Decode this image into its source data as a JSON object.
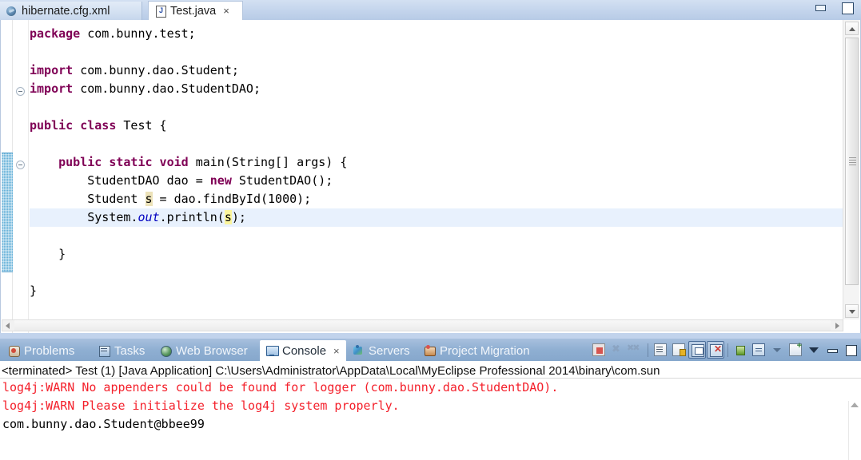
{
  "editor": {
    "tabs": [
      {
        "label": "hibernate.cfg.xml",
        "icon": "xml-file-icon",
        "active": false,
        "closable": false
      },
      {
        "label": "Test.java",
        "icon": "java-file-icon",
        "active": true,
        "closable": true,
        "close_glyph": "×"
      }
    ],
    "window_controls": {
      "minimize": "minimize-button",
      "maximize": "maximize-button"
    },
    "code_lines": [
      {
        "id": "l1",
        "tokens": [
          {
            "t": "kw",
            "s": "package"
          },
          {
            "t": "plain",
            "s": " com.bunny.test;"
          }
        ],
        "indent": 0,
        "highlighted": false,
        "fold": false
      },
      {
        "id": "l2",
        "tokens": [],
        "indent": 0,
        "highlighted": false,
        "fold": false
      },
      {
        "id": "l3",
        "tokens": [
          {
            "t": "kw",
            "s": "import"
          },
          {
            "t": "plain",
            "s": " com.bunny.dao.Student;"
          }
        ],
        "indent": 0,
        "highlighted": false,
        "fold": true
      },
      {
        "id": "l4",
        "tokens": [
          {
            "t": "kw",
            "s": "import"
          },
          {
            "t": "plain",
            "s": " com.bunny.dao.StudentDAO;"
          }
        ],
        "indent": 0,
        "highlighted": false,
        "fold": false
      },
      {
        "id": "l5",
        "tokens": [],
        "indent": 0,
        "highlighted": false,
        "fold": false
      },
      {
        "id": "l6",
        "tokens": [
          {
            "t": "kw",
            "s": "public class"
          },
          {
            "t": "plain",
            "s": " Test {"
          }
        ],
        "indent": 0,
        "highlighted": false,
        "fold": false
      },
      {
        "id": "l7",
        "tokens": [],
        "indent": 0,
        "highlighted": false,
        "fold": false
      },
      {
        "id": "l8",
        "tokens": [
          {
            "t": "plain",
            "s": "    "
          },
          {
            "t": "kw",
            "s": "public static void"
          },
          {
            "t": "plain",
            "s": " main(String[] args) {"
          }
        ],
        "indent": 0,
        "highlighted": false,
        "fold": true
      },
      {
        "id": "l9",
        "tokens": [
          {
            "t": "plain",
            "s": "        StudentDAO dao = "
          },
          {
            "t": "kw",
            "s": "new"
          },
          {
            "t": "plain",
            "s": " StudentDAO();"
          }
        ],
        "indent": 0,
        "highlighted": false,
        "fold": false
      },
      {
        "id": "l10",
        "tokens": [
          {
            "t": "plain",
            "s": "        Student "
          },
          {
            "t": "occ-dim",
            "s": "s"
          },
          {
            "t": "plain",
            "s": " = dao.findById(1000);"
          }
        ],
        "indent": 0,
        "highlighted": false,
        "fold": false
      },
      {
        "id": "l11",
        "tokens": [
          {
            "t": "plain",
            "s": "        System."
          },
          {
            "t": "field",
            "s": "out"
          },
          {
            "t": "plain",
            "s": ".println("
          },
          {
            "t": "occ",
            "s": "s"
          },
          {
            "t": "plain",
            "s": ");"
          }
        ],
        "indent": 0,
        "highlighted": true,
        "fold": false
      },
      {
        "id": "l12",
        "tokens": [],
        "indent": 0,
        "highlighted": false,
        "fold": false
      },
      {
        "id": "l13",
        "tokens": [
          {
            "t": "plain",
            "s": "    }"
          }
        ],
        "indent": 0,
        "highlighted": false,
        "fold": false
      },
      {
        "id": "l14",
        "tokens": [],
        "indent": 0,
        "highlighted": false,
        "fold": false
      },
      {
        "id": "l15",
        "tokens": [
          {
            "t": "plain",
            "s": "}"
          }
        ],
        "indent": 0,
        "highlighted": false,
        "fold": false
      }
    ],
    "scrollbars": {
      "vertical_name": "editor-vertical-scrollbar",
      "horizontal_name": "editor-horizontal-scrollbar"
    }
  },
  "console_panel": {
    "tabs": [
      {
        "label": "Problems",
        "icon": "problems-icon",
        "active": false,
        "closable": false
      },
      {
        "label": "Tasks",
        "icon": "tasks-icon",
        "active": false,
        "closable": false
      },
      {
        "label": "Web Browser",
        "icon": "browser-icon",
        "active": false,
        "closable": false
      },
      {
        "label": "Console",
        "icon": "console-icon",
        "active": true,
        "closable": true,
        "close_glyph": "×"
      },
      {
        "label": "Servers",
        "icon": "servers-icon",
        "active": false,
        "closable": false
      },
      {
        "label": "Project Migration",
        "icon": "migration-icon",
        "active": false,
        "closable": false
      }
    ],
    "toolbar_buttons": [
      {
        "name": "terminate-button",
        "glyph": "gl-terminate",
        "framed": false
      },
      {
        "name": "remove-launch-button",
        "glyph": "gl-remove",
        "framed": false
      },
      {
        "name": "remove-all-launches-button",
        "glyph": "gl-removeall",
        "framed": false
      },
      {
        "name": "separator-1",
        "glyph": "sep",
        "framed": false
      },
      {
        "name": "clear-console-button",
        "glyph": "gl-page",
        "framed": false
      },
      {
        "name": "scroll-lock-button",
        "glyph": "gl-lock",
        "framed": false
      },
      {
        "name": "show-console-button",
        "glyph": "gl-win",
        "framed": true
      },
      {
        "name": "close-console-button",
        "glyph": "gl-winx",
        "framed": true
      },
      {
        "name": "separator-2",
        "glyph": "sep",
        "framed": false
      },
      {
        "name": "pin-console-button",
        "glyph": "gl-pin",
        "framed": false
      },
      {
        "name": "display-selected-console",
        "glyph": "gl-display",
        "framed": false
      },
      {
        "name": "display-dropdown-arrow",
        "glyph": "gl-caret",
        "framed": false
      },
      {
        "name": "open-console-button",
        "glyph": "gl-newcon",
        "framed": false
      },
      {
        "name": "open-console-dropdown-arrow",
        "glyph": "gl-caretdark",
        "framed": false
      },
      {
        "name": "minimize-panel-button",
        "glyph": "gl-minimize",
        "framed": false
      },
      {
        "name": "maximize-panel-button",
        "glyph": "gl-maximize",
        "framed": false
      }
    ],
    "header": "<terminated> Test (1) [Java Application] C:\\Users\\Administrator\\AppData\\Local\\MyEclipse Professional 2014\\binary\\com.sun",
    "output_lines": [
      {
        "text": "log4j:WARN No appenders could be found for logger (com.bunny.dao.StudentDAO).",
        "color": "red"
      },
      {
        "text": "log4j:WARN Please initialize the log4j system properly.",
        "color": "red"
      },
      {
        "text": "com.bunny.dao.Student@bbee99",
        "color": "black"
      }
    ]
  },
  "colors": {
    "keyword": "#7f0055",
    "static_field": "#0000c0",
    "occurrence_highlight": "#fbf59c",
    "current_line": "#e8f1fd",
    "console_error": "#f4202b",
    "chrome_blue": "#8fafd2",
    "gutter_mark": "#64b0d8"
  }
}
